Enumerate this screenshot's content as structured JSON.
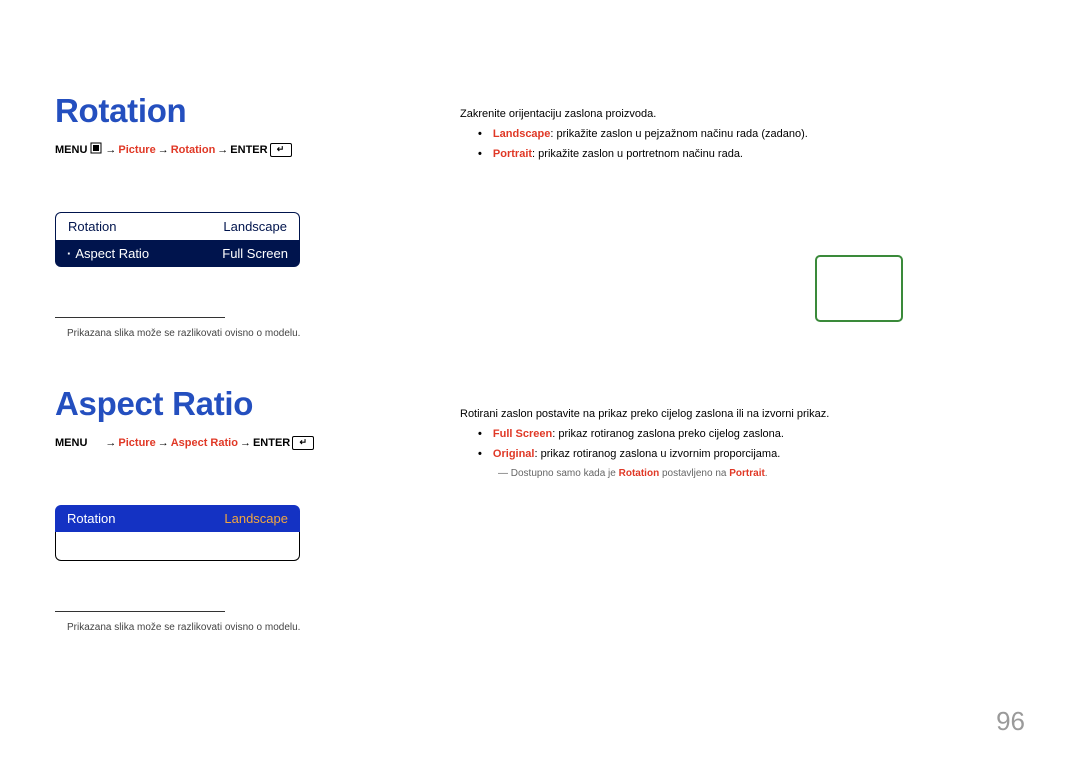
{
  "section1": {
    "title": "Rotation",
    "menu_path": {
      "prefix": "MENU",
      "seg1": "Picture",
      "seg2": "Rotation",
      "suffix": "ENTER"
    },
    "ui": {
      "row1_label": "Rotation",
      "row1_value": "Landscape",
      "row2_label": "Aspect Ratio",
      "row2_value": "Full Screen"
    },
    "footnote": "Prikazana slika može se razlikovati ovisno o modelu.",
    "desc_main": "Zakrenite orijentaciju zaslona proizvoda.",
    "opt_landscape_kw": "Landscape",
    "opt_landscape_txt": ": prikažite zaslon u pejzažnom načinu rada (zadano).",
    "opt_portrait_kw": "Portrait",
    "opt_portrait_txt": ": prikažite zaslon u portretnom načinu rada."
  },
  "section2": {
    "title": "Aspect Ratio",
    "menu_path": {
      "prefix": "MENU",
      "seg1": "Picture",
      "seg2": "Aspect Ratio",
      "suffix": "ENTER"
    },
    "ui": {
      "row1_label": "Rotation",
      "row1_value": "Landscape"
    },
    "footnote": "Prikazana slika može se razlikovati ovisno o modelu.",
    "desc_main": "Rotirani zaslon postavite na prikaz preko cijelog zaslona ili na izvorni prikaz.",
    "opt_fs_kw": "Full Screen",
    "opt_fs_txt": ": prikaz rotiranog zaslona preko cijelog zaslona.",
    "opt_orig_kw": "Original",
    "opt_orig_txt": ": prikaz rotiranog zaslona u izvornim proporcijama.",
    "note_prefix": "― Dostupno samo kada je ",
    "note_kw1": "Rotation",
    "note_mid": " postavljeno na ",
    "note_kw2": "Portrait",
    "note_suffix": "."
  },
  "pagenum": "96",
  "arrow": "→"
}
